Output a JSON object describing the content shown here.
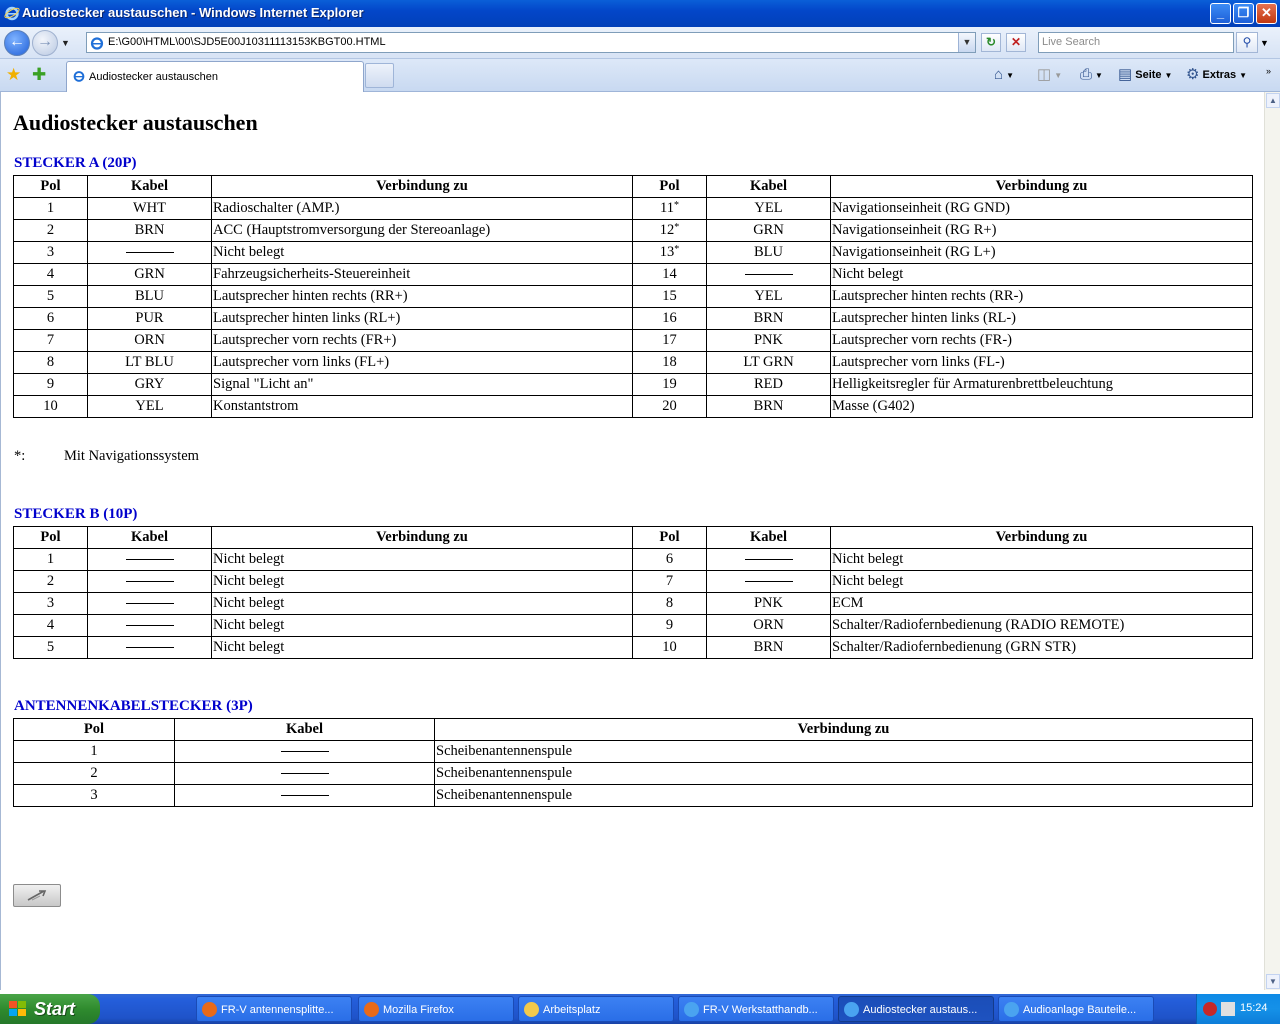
{
  "window": {
    "title": "Audiostecker austauschen - Windows Internet Explorer",
    "minimize": "_",
    "maximize": "❐",
    "close": "✕"
  },
  "addressbar": {
    "url": "E:\\G00\\HTML\\00\\SJD5E00J10311113153KBGT00.HTML",
    "search_placeholder": "Live Search",
    "refresh": "↻",
    "stop": "✕"
  },
  "tabs": [
    {
      "label": "Audiostecker austauschen"
    }
  ],
  "toolbar": {
    "home": "⌂",
    "page_label": "Seite",
    "tools_label": "Extras"
  },
  "page": {
    "title": "Audiostecker austauschen",
    "footnote_mark": "*:",
    "footnote_text": "Mit Navigationssystem"
  },
  "sections": {
    "a_title": "STECKER A (20P)",
    "b_title": "STECKER B (10P)",
    "c_title": "ANTENNENKABELSTECKER (3P)"
  },
  "table_headers": {
    "pol": "Pol",
    "kabel": "Kabel",
    "verbindung": "Verbindung zu"
  },
  "connector_a": [
    {
      "pol": "1",
      "kabel": "WHT",
      "verb": "Radioschalter (AMP.)",
      "pol2": "11",
      "ast": "*",
      "kabel2": "YEL",
      "verb2": "Navigationseinheit (RG GND)"
    },
    {
      "pol": "2",
      "kabel": "BRN",
      "verb": "ACC (Hauptstromversorgung der Stereoanlage)",
      "pol2": "12",
      "ast": "*",
      "kabel2": "GRN",
      "verb2": "Navigationseinheit (RG R+)"
    },
    {
      "pol": "3",
      "kabel": "",
      "verb": "Nicht belegt",
      "pol2": "13",
      "ast": "*",
      "kabel2": "BLU",
      "verb2": "Navigationseinheit (RG L+)"
    },
    {
      "pol": "4",
      "kabel": "GRN",
      "verb": "Fahrzeugsicherheits-Steuereinheit",
      "pol2": "14",
      "ast": "",
      "kabel2": "",
      "verb2": "Nicht belegt"
    },
    {
      "pol": "5",
      "kabel": "BLU",
      "verb": "Lautsprecher hinten rechts (RR+)",
      "pol2": "15",
      "ast": "",
      "kabel2": "YEL",
      "verb2": "Lautsprecher hinten rechts (RR-)"
    },
    {
      "pol": "6",
      "kabel": "PUR",
      "verb": "Lautsprecher hinten links (RL+)",
      "pol2": "16",
      "ast": "",
      "kabel2": "BRN",
      "verb2": "Lautsprecher hinten links (RL-)"
    },
    {
      "pol": "7",
      "kabel": "ORN",
      "verb": "Lautsprecher vorn rechts (FR+)",
      "pol2": "17",
      "ast": "",
      "kabel2": "PNK",
      "verb2": "Lautsprecher vorn rechts (FR-)"
    },
    {
      "pol": "8",
      "kabel": "LT BLU",
      "verb": "Lautsprecher vorn links (FL+)",
      "pol2": "18",
      "ast": "",
      "kabel2": "LT GRN",
      "verb2": "Lautsprecher vorn links (FL-)"
    },
    {
      "pol": "9",
      "kabel": "GRY",
      "verb": "Signal \"Licht an\"",
      "pol2": "19",
      "ast": "",
      "kabel2": "RED",
      "verb2": "Helligkeitsregler für Armaturenbrettbeleuchtung"
    },
    {
      "pol": "10",
      "kabel": "YEL",
      "verb": "Konstantstrom",
      "pol2": "20",
      "ast": "",
      "kabel2": "BRN",
      "verb2": "Masse (G402)"
    }
  ],
  "connector_b": [
    {
      "pol": "1",
      "kabel": "",
      "verb": "Nicht belegt",
      "pol2": "6",
      "kabel2": "",
      "verb2": "Nicht belegt"
    },
    {
      "pol": "2",
      "kabel": "",
      "verb": "Nicht belegt",
      "pol2": "7",
      "kabel2": "",
      "verb2": "Nicht belegt"
    },
    {
      "pol": "3",
      "kabel": "",
      "verb": "Nicht belegt",
      "pol2": "8",
      "kabel2": "PNK",
      "verb2": "ECM"
    },
    {
      "pol": "4",
      "kabel": "",
      "verb": "Nicht belegt",
      "pol2": "9",
      "kabel2": "ORN",
      "verb2": "Schalter/Radiofernbedienung (RADIO REMOTE)"
    },
    {
      "pol": "5",
      "kabel": "",
      "verb": "Nicht belegt",
      "pol2": "10",
      "kabel2": "BRN",
      "verb2": "Schalter/Radiofernbedienung (GRN STR)"
    }
  ],
  "connector_c": [
    {
      "pol": "1",
      "kabel": "",
      "verb": "Scheibenantennenspule"
    },
    {
      "pol": "2",
      "kabel": "",
      "verb": "Scheibenantennenspule"
    },
    {
      "pol": "3",
      "kabel": "",
      "verb": "Scheibenantennenspule"
    }
  ],
  "taskbar": {
    "start_label": "Start",
    "clock": "15:24",
    "tasks": [
      {
        "label": "FR-V antennensplitte...",
        "icon": "firefox-icon"
      },
      {
        "label": "Mozilla Firefox",
        "icon": "firefox-icon"
      },
      {
        "label": "Arbeitsplatz",
        "icon": "folder-icon"
      },
      {
        "label": "FR-V Werkstatthandb...",
        "icon": "ie-icon"
      },
      {
        "label": "Audiostecker austaus...",
        "icon": "ie-icon"
      },
      {
        "label": "Audioanlage Bauteile...",
        "icon": "ie-icon"
      }
    ]
  },
  "colors": {
    "section_title": "#0000cc",
    "titlebar": "#0346c9",
    "taskbar": "#245edb"
  }
}
